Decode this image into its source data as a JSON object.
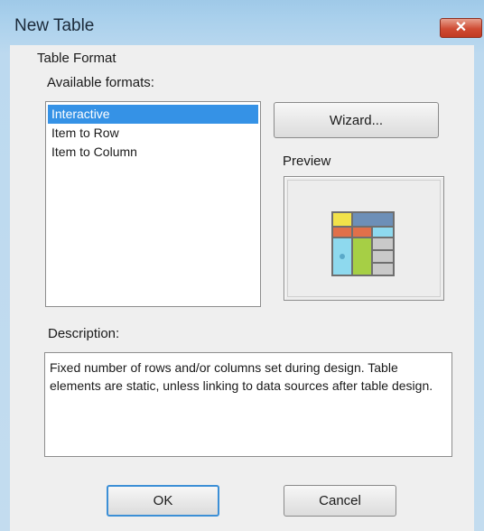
{
  "window": {
    "title": "New Table"
  },
  "table_format": {
    "group_label": "Table Format",
    "available_label": "Available formats:",
    "formats": [
      "Interactive",
      "Item to Row",
      "Item to Column"
    ],
    "selected_index": 0
  },
  "wizard_button": "Wizard...",
  "preview": {
    "label": "Preview"
  },
  "description": {
    "label": "Description:",
    "text": "Fixed number of rows and/or columns set during design. Table elements are static, unless linking to data sources after table design."
  },
  "buttons": {
    "ok": "OK",
    "cancel": "Cancel"
  },
  "colors": {
    "selection": "#3592e6",
    "accent_border": "#3c8fd6",
    "close": "#cf4b33"
  }
}
